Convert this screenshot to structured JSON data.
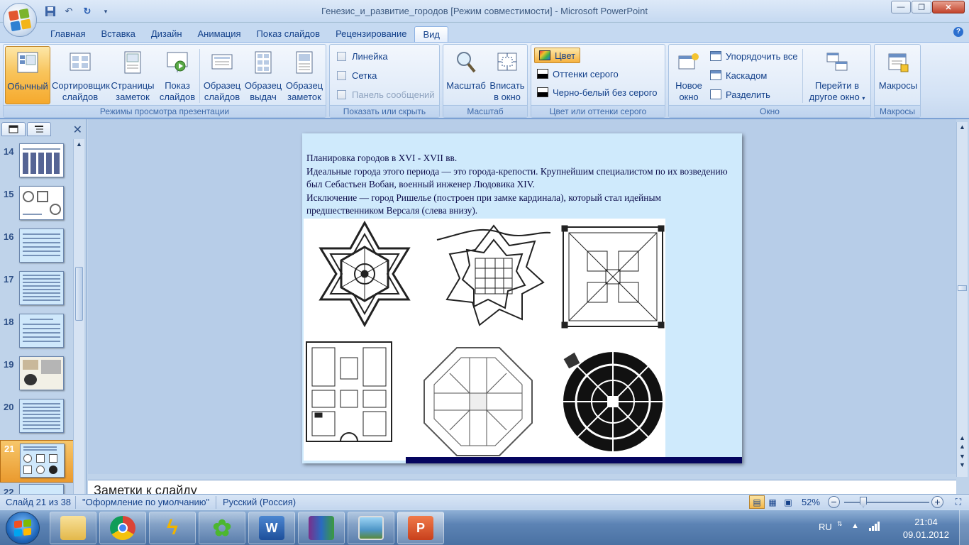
{
  "window": {
    "title": "Генезис_и_развитие_городов [Режим совместимости] - Microsoft PowerPoint"
  },
  "tabs": [
    {
      "label": "Главная"
    },
    {
      "label": "Вставка"
    },
    {
      "label": "Дизайн"
    },
    {
      "label": "Анимация"
    },
    {
      "label": "Показ слайдов"
    },
    {
      "label": "Рецензирование"
    },
    {
      "label": "Вид"
    }
  ],
  "ribbon": {
    "views": {
      "label": "Режимы просмотра презентации",
      "normal": "Обычный",
      "sorter1": "Сортировщик",
      "sorter2": "слайдов",
      "notes1": "Страницы",
      "notes2": "заметок",
      "show1": "Показ",
      "show2": "слайдов",
      "master1": "Образец",
      "master2": "слайдов",
      "handout1": "Образец",
      "handout2": "выдач",
      "notesmaster1": "Образец",
      "notesmaster2": "заметок"
    },
    "showhide": {
      "label": "Показать или скрыть",
      "ruler": "Линейка",
      "grid": "Сетка",
      "msgbar": "Панель сообщений"
    },
    "zoom": {
      "label": "Масштаб",
      "zoom": "Масштаб",
      "fit1": "Вписать",
      "fit2": "в окно"
    },
    "color": {
      "label": "Цвет или оттенки серого",
      "color": "Цвет",
      "gray": "Оттенки серого",
      "bw": "Черно-белый без серого"
    },
    "window": {
      "label": "Окно",
      "new1": "Новое",
      "new2": "окно",
      "arrange": "Упорядочить все",
      "cascade": "Каскадом",
      "split": "Разделить",
      "switch1": "Перейти в",
      "switch2": "другое окно"
    },
    "macros": {
      "label": "Макросы",
      "macros": "Макросы"
    }
  },
  "thumbnails": [
    {
      "num": "14"
    },
    {
      "num": "15"
    },
    {
      "num": "16"
    },
    {
      "num": "17"
    },
    {
      "num": "18"
    },
    {
      "num": "19"
    },
    {
      "num": "20"
    },
    {
      "num": "21"
    },
    {
      "num": "22"
    }
  ],
  "slide": {
    "line1": "Планировка городов в XVI - XVII вв.",
    "line2": "Идеальные города этого периода — это города-крепости. Крупнейшим специалистом по их возведению был Себастьен Вобан, военный инженер Людовика XIV.",
    "line3": "Исключение — город Ришелье (построен при замке кардинала), который стал идейным предшественником Версаля (слева внизу)."
  },
  "notes": {
    "text": "Заметки к слайду"
  },
  "status": {
    "slide": "Слайд 21 из 38",
    "theme": "\"Оформление по умолчанию\"",
    "lang": "Русский (Россия)",
    "zoom": "52%"
  },
  "taskbar": {
    "lang": "RU",
    "time": "21:04",
    "date": "09.01.2012"
  }
}
